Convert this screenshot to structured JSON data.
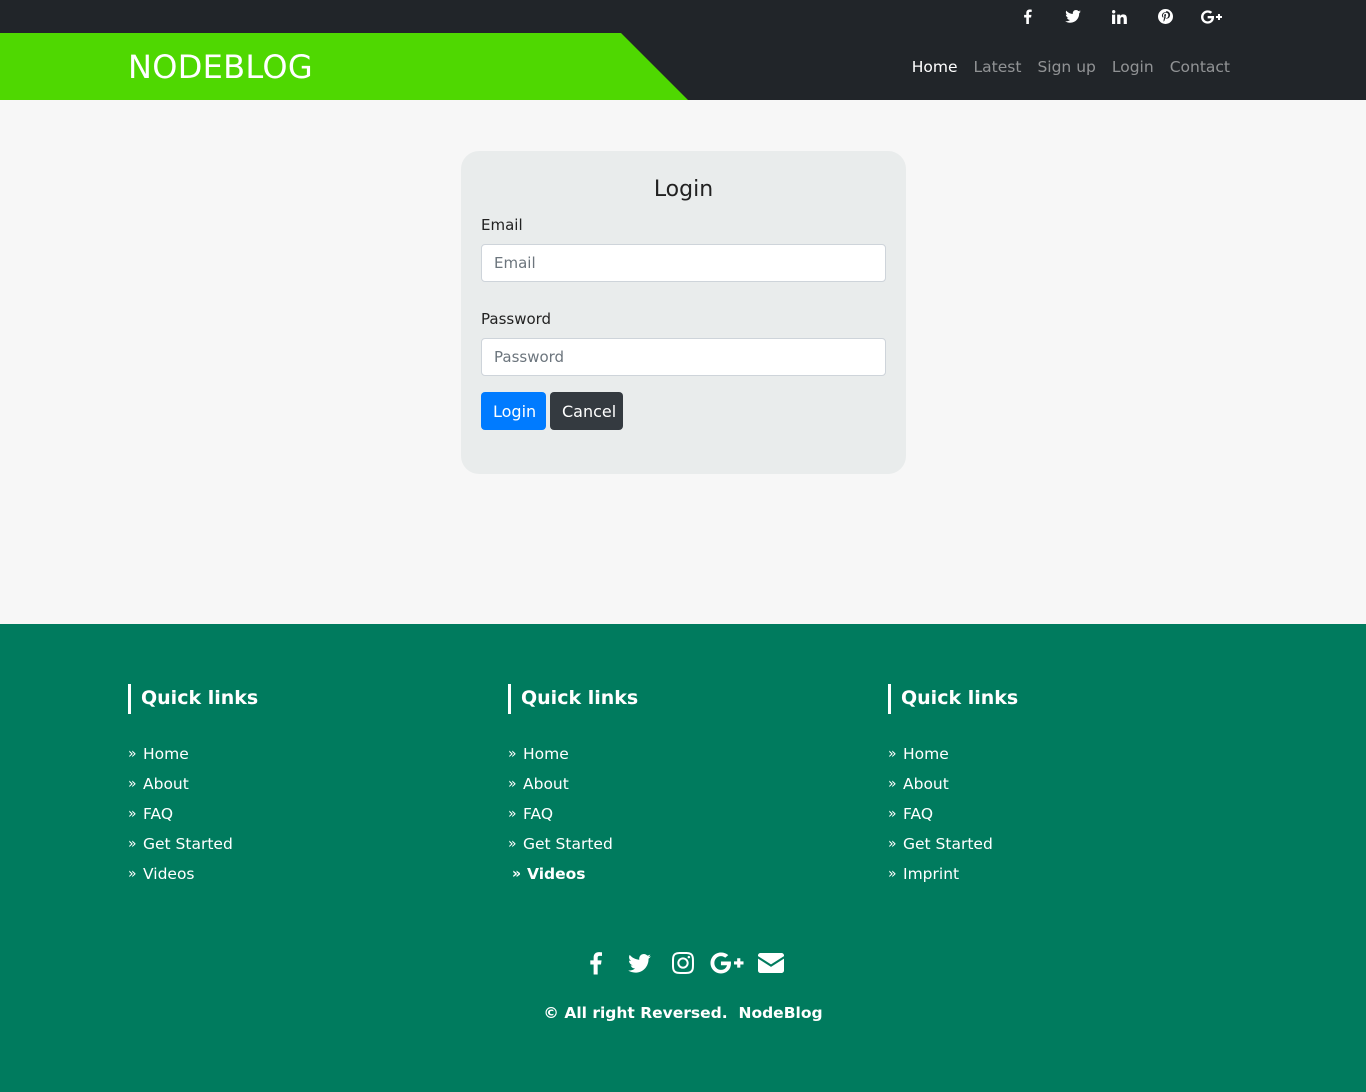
{
  "topbar": {
    "social_icons": [
      "facebook-icon",
      "twitter-icon",
      "linkedin-icon",
      "pinterest-icon",
      "google-plus-icon"
    ]
  },
  "navbar": {
    "brand": "NODEBLOG",
    "brand_color": "#4fd801",
    "items": [
      {
        "label": "Home",
        "active": true
      },
      {
        "label": "Latest"
      },
      {
        "label": "Sign up"
      },
      {
        "label": "Login"
      },
      {
        "label": "Contact"
      }
    ]
  },
  "login": {
    "title": "Login",
    "email_label": "Email",
    "email_placeholder": "Email",
    "email_value": "",
    "password_label": "Password",
    "password_placeholder": "Password",
    "password_value": "",
    "login_button": "Login",
    "cancel_button": "Cancel"
  },
  "footer": {
    "background": "#007b5e",
    "columns": [
      {
        "title": "Quick links",
        "links": [
          "Home",
          "About",
          "FAQ",
          "Get Started",
          "Videos"
        ]
      },
      {
        "title": "Quick links",
        "links": [
          "Home",
          "About",
          "FAQ",
          "Get Started",
          "Videos"
        ]
      },
      {
        "title": "Quick links",
        "links": [
          "Home",
          "About",
          "FAQ",
          "Get Started",
          "Imprint"
        ]
      }
    ],
    "social_icons": [
      "facebook-icon",
      "twitter-icon",
      "instagram-icon",
      "google-plus-icon",
      "envelope-icon"
    ],
    "copyright": "© All right Reversed.",
    "copyright_brand": "NodeBlog"
  }
}
